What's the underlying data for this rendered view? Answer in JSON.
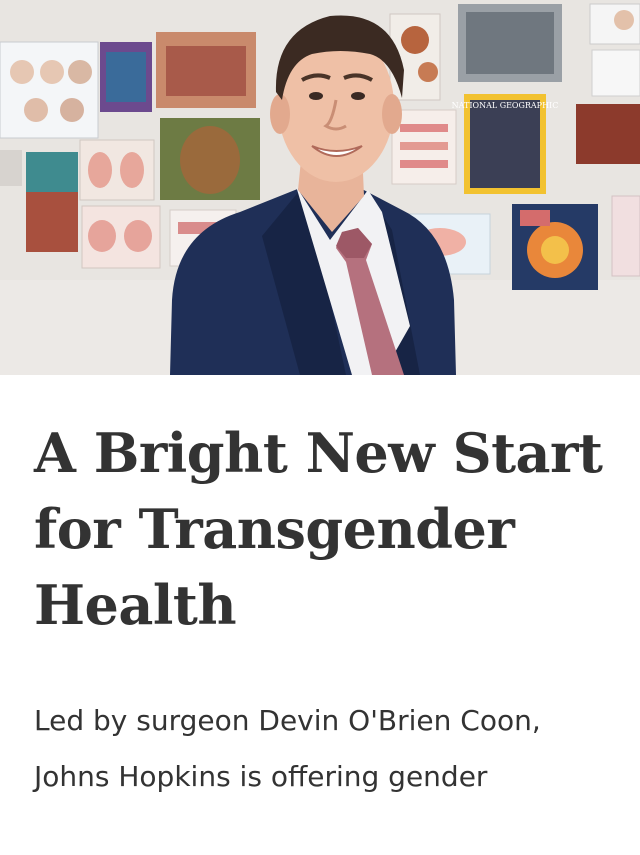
{
  "hero": {
    "image_icon": "portrait-photo",
    "magazine_cover_text": "NATIONAL GEOGRAPHIC"
  },
  "article": {
    "headline": "A Bright New Start for Transgender Health",
    "dek": "Led by surgeon Devin O'Brien Coon, Johns Hopkins is offering gender"
  },
  "colors": {
    "text": "#333333",
    "background": "#ffffff",
    "suit": "#1f2f57",
    "tie": "#b5717e"
  }
}
